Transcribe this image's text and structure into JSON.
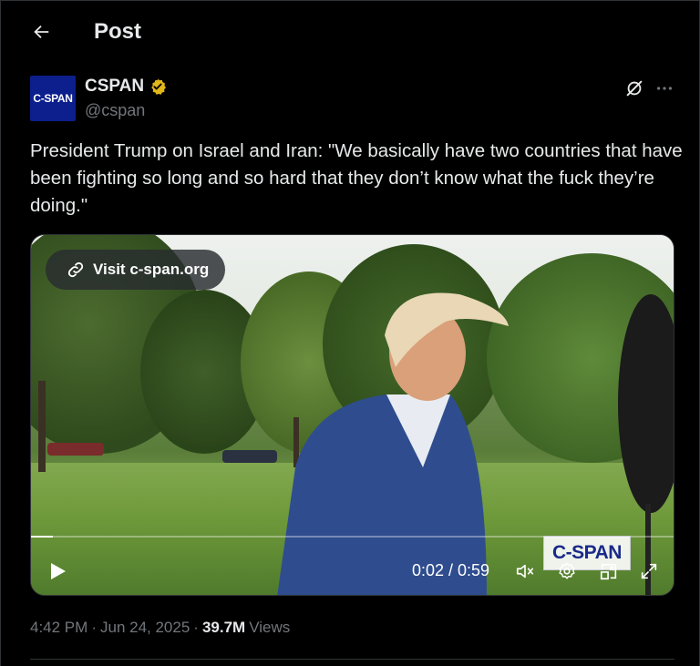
{
  "header": {
    "title": "Post",
    "back_icon": "arrow-left-icon"
  },
  "author": {
    "avatar_text": "C-SPAN",
    "name": "CSPAN",
    "handle": "@cspan",
    "verified_color": "#e2b719"
  },
  "post": {
    "text": "President Trump on Israel and Iran: \"We basically have two countries that have been fighting so long and so hard that they don’t know what the fuck they’re doing.\""
  },
  "media": {
    "link_label": "Visit c-span.org",
    "watermark": "C-SPAN",
    "time": "0:02 / 0:59",
    "progress_fraction": 0.034,
    "controls": [
      "play-icon",
      "volume-muted-icon",
      "settings-icon",
      "picture-in-picture-icon",
      "fullscreen-icon"
    ]
  },
  "meta": {
    "time": "4:42 PM",
    "date": "Jun 24, 2025",
    "views_count": "39.7M",
    "views_label": "Views"
  },
  "colors": {
    "background": "#000000",
    "text": "#e7e9ea",
    "secondary": "#71767b",
    "avatar_bg": "#0c1f8c"
  }
}
